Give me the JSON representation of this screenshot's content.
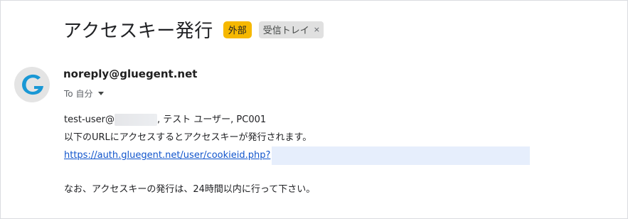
{
  "subject": "アクセスキー発行",
  "labels": {
    "external": "外部",
    "inbox": "受信トレイ",
    "remove_icon": "×"
  },
  "sender": {
    "email": "noreply@gluegent.net",
    "avatar_icon": "gluegent-logo",
    "avatar_color": "#1a98d5"
  },
  "recipient": {
    "text": "To 自分"
  },
  "body": {
    "greeting_prefix": "test-user@",
    "greeting_suffix": ", テスト ユーザー, PC001",
    "line2": "以下のURLにアクセスするとアクセスキーが発行されます。",
    "link": "https://auth.gluegent.net/user/cookieid.php?",
    "line4": "なお、アクセスキーの発行は、24時間以内に行って下さい。"
  }
}
